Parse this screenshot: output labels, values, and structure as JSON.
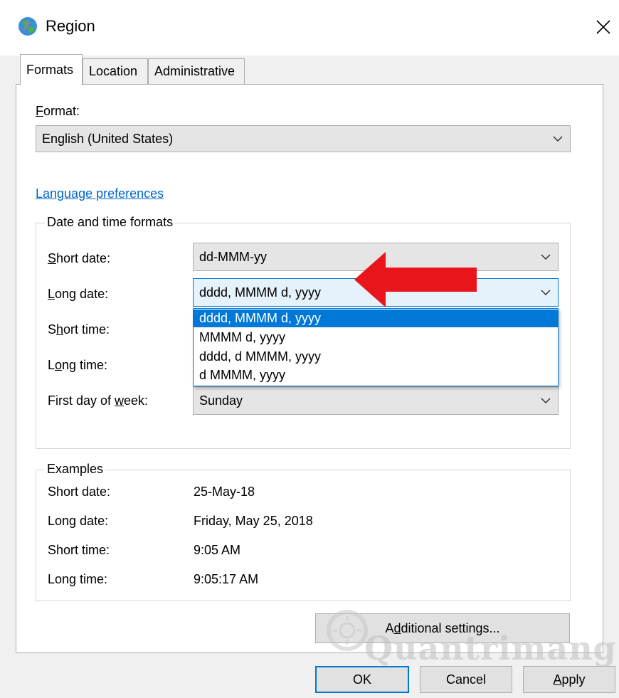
{
  "window": {
    "title": "Region"
  },
  "tabs": [
    {
      "label": "Formats"
    },
    {
      "label": "Location"
    },
    {
      "label": "Administrative"
    }
  ],
  "format": {
    "label_first": "F",
    "label_rest": "ormat:",
    "value": "English (United States)"
  },
  "language_link": "Language preferences",
  "date_time_group": {
    "legend": "Date and time formats",
    "short_date": {
      "pre": "",
      "ul": "S",
      "post": "hort date:",
      "value": "dd-MMM-yy"
    },
    "long_date": {
      "pre": "",
      "ul": "L",
      "post": "ong date:",
      "value": "dddd, MMMM d, yyyy"
    },
    "short_time": {
      "pre": "S",
      "ul": "h",
      "post": "ort time:"
    },
    "long_time": {
      "pre": "L",
      "ul": "o",
      "post": "ng time:"
    },
    "first_day": {
      "pre": "First day of ",
      "ul": "w",
      "post": "eek:",
      "value": "Sunday"
    }
  },
  "long_date_dropdown": {
    "options": [
      "dddd, MMMM d, yyyy",
      "MMMM d, yyyy",
      "dddd, d MMMM, yyyy",
      "d MMMM, yyyy"
    ],
    "selected_index": 0
  },
  "examples": {
    "legend": "Examples",
    "rows": [
      {
        "label": "Short date:",
        "value": "25-May-18"
      },
      {
        "label": "Long date:",
        "value": "Friday, May 25, 2018"
      },
      {
        "label": "Short time:",
        "value": "9:05 AM"
      },
      {
        "label": "Long time:",
        "value": "9:05:17 AM"
      }
    ]
  },
  "buttons": {
    "additional": {
      "pre": "A",
      "ul": "d",
      "post": "ditional settings..."
    },
    "ok": "OK",
    "cancel": "Cancel",
    "apply": {
      "ul": "A",
      "post": "pply"
    }
  },
  "watermark": "Quantrimang",
  "colors": {
    "accent": "#0078d7",
    "arrow": "#e8161b",
    "link": "#0066cc"
  }
}
